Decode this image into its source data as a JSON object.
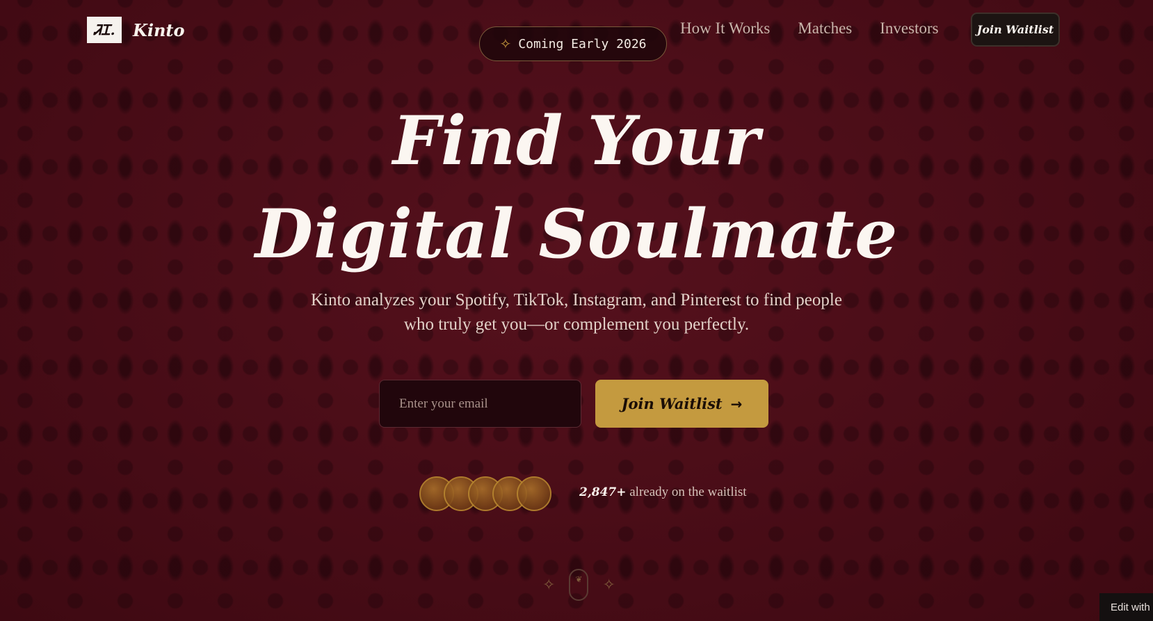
{
  "brand": {
    "mark": "ᏘᏆ.",
    "name": "Kinto"
  },
  "badge": {
    "icon": "sparkle-icon",
    "text": "Coming Early 2026"
  },
  "nav": {
    "items": [
      "How It Works",
      "Matches",
      "Investors"
    ],
    "cta": "Join Waitlist"
  },
  "hero": {
    "line1": "Find Your",
    "line2": "Digital Soulmate",
    "subtitle_line1": "Kinto analyzes your Spotify, TikTok, Instagram, and Pinterest to find people",
    "subtitle_line2": "who truly get you—or complement you perfectly."
  },
  "form": {
    "email_placeholder": "Enter your email",
    "submit_label": "Join Waitlist",
    "submit_icon": "arrow-right-icon"
  },
  "social_proof": {
    "count": "2,847+",
    "text": " already on the waitlist",
    "avatar_count": 5
  },
  "footer_badge": {
    "text": "Edit with"
  },
  "colors": {
    "background": "#4a0c16",
    "accent": "#c49a3f",
    "text": "#fbf6f1"
  }
}
